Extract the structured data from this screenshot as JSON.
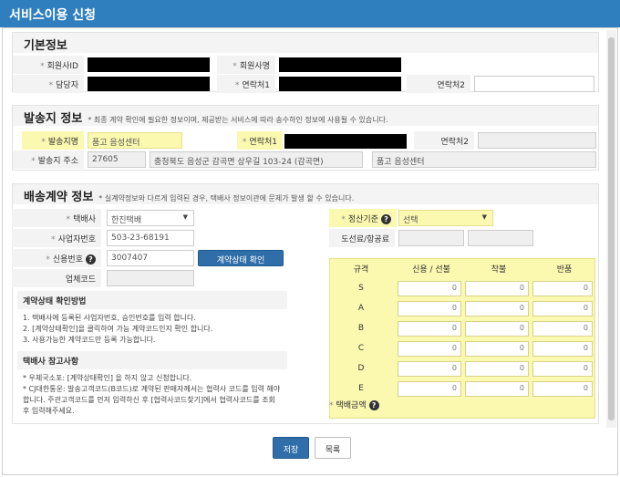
{
  "window": {
    "title": "서비스이용 신청"
  },
  "basic": {
    "heading": "기본정보",
    "member_id_label": "회원사ID",
    "member_name_label": "회원사명",
    "manager_label": "담당자",
    "contact1_label": "연락처1",
    "contact2_label": "연락처2",
    "contact2_value": ""
  },
  "origin": {
    "heading": "발송지 정보",
    "note": "* 최종 계약 확인에 필요한 정보이며, 제공받는 서비스에 따라 송수하인 정보에 사용될 수 있습니다.",
    "sender_label": "발송지명",
    "sender_value": "품고 음성센터",
    "contact1_label": "연락처1",
    "contact2_label": "연락처2",
    "address_label": "발송지 주소",
    "zip": "27605",
    "address": "충청북도 음성군 감곡면 상우길 103-24 (감곡면)",
    "address_detail": "품고 음성센터"
  },
  "contract": {
    "heading": "배송계약 정보",
    "note": "* 실계약정보와 다르게 입력된 경우, 택배사 정보이관에 문제가 발생 할 수 있습니다.",
    "courier_label": "택배사",
    "courier_value": "한진택배",
    "bizno_label": "사업자번호",
    "bizno_value": "503-23-68191",
    "credit_label": "신용번호",
    "credit_value": "3007407",
    "check_button": "계약상태 확인",
    "company_code_label": "업체코드",
    "settle_label": "정산기준",
    "settle_value": "선택",
    "island_label": "도선료/항공료",
    "guide_title": "계약상태 확인방법",
    "guide_lines": [
      "1. 택배사에 등록된 사업자번호, 승인번호를 입력 합니다.",
      "2. [계약상태확인]을 클릭하여 가능 계약코드인지 확인 합니다.",
      "3. 사용가능한 계약코드만 등록 가능합니다."
    ],
    "ref_title": "택배사 참고사항",
    "ref_line1": "* 우체국소포: [계약상태확인] 을 하지 않고 신청합니다.",
    "ref_line2": "* CJ대한통운: 발송고객코드(B코드)로 계약된 판매자께서는 협력사 코드를 입력 해야 합니다. 주관고객코드를 먼저 입력하신 후 [협력사코드찾기]에서 협력사코드를 조회 후 입력해주세요.",
    "fee_label": "택배금액"
  },
  "grid": {
    "headers": [
      "규격",
      "신용 / 선불",
      "착불",
      "반품"
    ],
    "rows": [
      {
        "size": "S",
        "values": [
          "0",
          "0",
          "0"
        ]
      },
      {
        "size": "A",
        "values": [
          "0",
          "0",
          "0"
        ]
      },
      {
        "size": "B",
        "values": [
          "0",
          "0",
          "0"
        ]
      },
      {
        "size": "C",
        "values": [
          "0",
          "0",
          "0"
        ]
      },
      {
        "size": "D",
        "values": [
          "0",
          "0",
          "0"
        ]
      },
      {
        "size": "E",
        "values": [
          "0",
          "0",
          "0"
        ]
      }
    ]
  },
  "footer": {
    "save": "저장",
    "list": "목록"
  },
  "colors": {
    "title_bar": "#2f7fbf",
    "highlight": "#fbf8b0",
    "primary_button": "#2f6ea8"
  }
}
